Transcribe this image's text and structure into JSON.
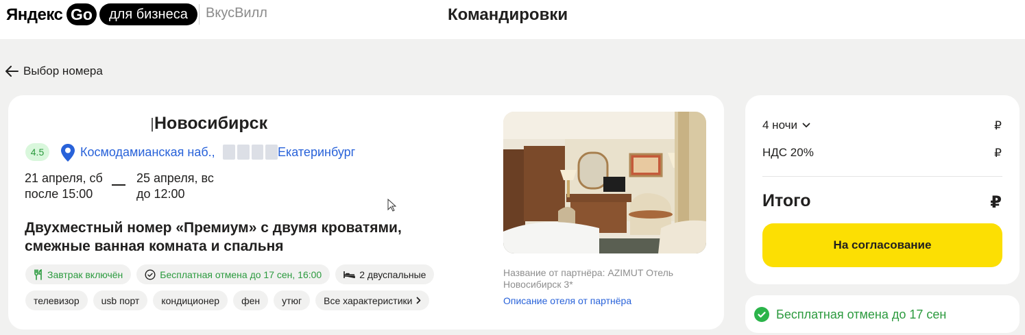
{
  "header": {
    "logo_yandex": "Яндекс",
    "logo_go": "Go",
    "logo_business": "для бизнеса",
    "company": "ВкусВилл",
    "title": "Командировки"
  },
  "back": {
    "icon": "arrow-left-icon",
    "label": "Выбор номера"
  },
  "hotel": {
    "name": "Новосибирск",
    "rating": "4.5",
    "address_start": "Космодамианская наб.,",
    "address_end": "Екатеринбург",
    "checkin_date": "21 апреля, сб",
    "checkin_time": "после 15:00",
    "checkout_date": "25 апреля, вс",
    "checkout_time": "до 12:00",
    "room_title": "Двухместный номер «Премиум» с двумя кроватями, смежные ванная комната и спальня",
    "features": [
      {
        "label": "Завтрак включён",
        "icon": "fork-knife-icon",
        "color": "#2b9a3e"
      },
      {
        "label": "Бесплатная отмена до 17 сен, 16:00",
        "icon": "check-circle-icon",
        "color": "#2b9a3e"
      },
      {
        "label": "2 двуспальные",
        "icon": "bed-icon",
        "color": "#21201f"
      },
      {
        "label": "телевизор"
      },
      {
        "label": "usb порт"
      },
      {
        "label": "кондиционер"
      },
      {
        "label": "фен"
      },
      {
        "label": "утюг"
      },
      {
        "label": "Все характеристики",
        "icon": "chevron-right-icon"
      }
    ],
    "partner_name": "Название от партнёра: AZIMUT Отель Новосибирск 3*",
    "partner_link": "Описание отеля от партнёра"
  },
  "summary": {
    "nights_label": "4 ночи",
    "nights_price": "₽",
    "vat_label": "НДС 20%",
    "vat_price": "₽",
    "total_label": "Итого",
    "total_price": "₽",
    "approve_button": "На согласование"
  },
  "free_cancel": {
    "icon": "check-circle-filled-icon",
    "label": "Бесплатная отмена до 17 сен"
  },
  "colors": {
    "accent_yellow": "#fcdf03",
    "link_blue": "#2862d9",
    "success_green": "#2b9a3e",
    "background": "#f1f1f0"
  }
}
